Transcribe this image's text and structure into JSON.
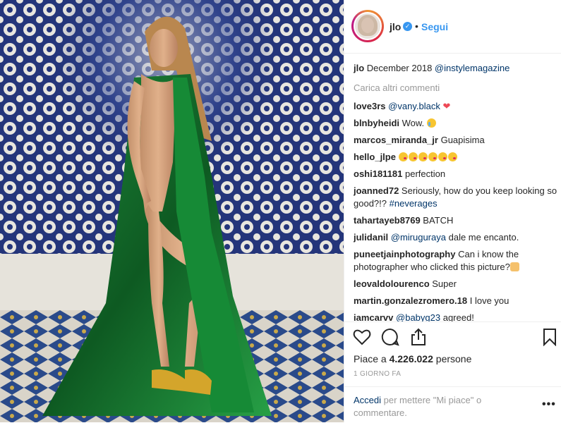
{
  "post": {
    "image_alt": "Woman in green sequined gown against blue tiled mosaic wall"
  },
  "header": {
    "username": "jlo",
    "verified_icon": "verified-badge-icon",
    "separator": "•",
    "follow_label": "Segui"
  },
  "caption": {
    "user": "jlo",
    "text": "December 2018",
    "mention": "@instylemagazine"
  },
  "load_more": "Carica altri commenti",
  "comments": [
    {
      "user": "love3rs",
      "mention": "@vany.black",
      "text": "",
      "icon": "red-heart-icon"
    },
    {
      "user": "blnbyheidi",
      "text": "Wow.",
      "icon": "crying-face-icon"
    },
    {
      "user": "marcos_miranda_jr",
      "text": "Guapisima"
    },
    {
      "user": "hello_jlpe",
      "text": "",
      "icon": "kissing-face-icon",
      "icon_count": 6
    },
    {
      "user": "oshi181181",
      "text": "perfection"
    },
    {
      "user": "joanned72",
      "text": "Seriously, how do you keep looking so good?!?",
      "hashtag": "#neverages"
    },
    {
      "user": "tahartayeb8769",
      "text": "BATCH"
    },
    {
      "user": "julidanil",
      "mention": "@miruguraya",
      "text": "dale me encanto."
    },
    {
      "user": "puneetjainphotography",
      "text": "Can i know the photographer who clicked this picture?",
      "icon": "raised-hands-icon"
    },
    {
      "user": "leovaldolourenco",
      "text": "Super"
    },
    {
      "user": "martin.gonzalezromero.18",
      "text": "I love you"
    },
    {
      "user": "iamcarvv",
      "mention": "@babyg23",
      "text": "agreed!"
    }
  ],
  "actions": {
    "like_icon": "heart-outline-icon",
    "comment_icon": "comment-bubble-icon",
    "share_icon": "share-upload-icon",
    "save_icon": "bookmark-icon"
  },
  "likes": {
    "prefix": "Piace a",
    "count": "4.226.022",
    "suffix": "persone"
  },
  "timestamp": "1 GIORNO FA",
  "login": {
    "link": "Accedi",
    "text": "per mettere \"Mi piace\" o commentare.",
    "more_icon": "more-options-icon",
    "more_glyph": "•••"
  }
}
